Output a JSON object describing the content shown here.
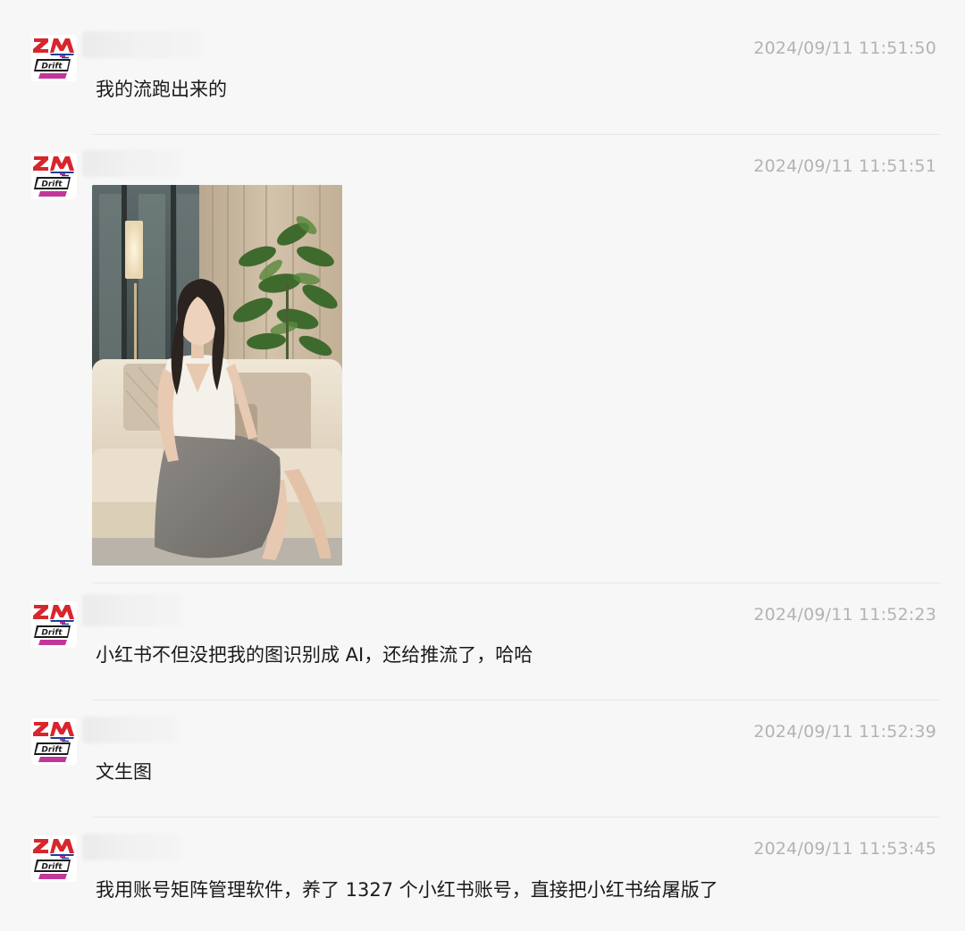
{
  "messages": [
    {
      "timestamp": "2024/09/11 11:51:50",
      "text": "我的流跑出来的"
    },
    {
      "timestamp": "2024/09/11 11:51:51",
      "type": "image"
    },
    {
      "timestamp": "2024/09/11 11:52:23",
      "text": "小红书不但没把我的图识别成 AI，还给推流了，哈哈"
    },
    {
      "timestamp": "2024/09/11 11:52:39",
      "text": "文生图"
    },
    {
      "timestamp": "2024/09/11 11:53:45",
      "text": "我用账号矩阵管理软件，养了 1327 个小红书账号，直接把小红书给屠版了"
    }
  ],
  "avatar": {
    "logo_text": "ZM",
    "sub_text": "DRIFT",
    "colors": {
      "red": "#d7262c",
      "blue": "#1f3f95",
      "magenta": "#c2359a"
    }
  }
}
